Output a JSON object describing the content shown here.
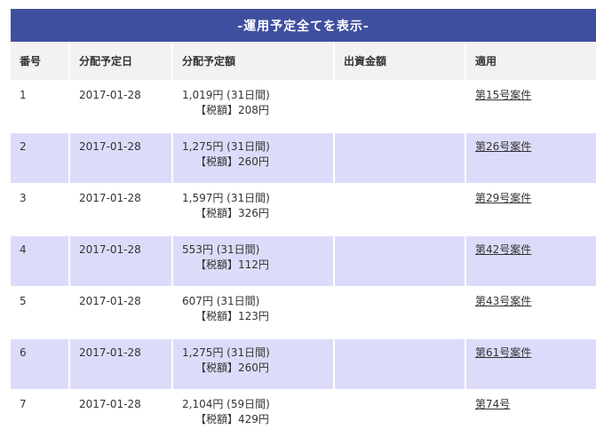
{
  "header": {
    "title": "-運用予定全てを表示-"
  },
  "table": {
    "columns": [
      "番号",
      "分配予定日",
      "分配予定額",
      "出資金額",
      "適用"
    ],
    "rows": [
      {
        "no": "1",
        "date": "2017-01-28",
        "amount": "1,019円 (31日間)",
        "tax": "【税額】208円",
        "investment": "",
        "apply": "第15号案件"
      },
      {
        "no": "2",
        "date": "2017-01-28",
        "amount": "1,275円 (31日間)",
        "tax": "【税額】260円",
        "investment": "",
        "apply": "第26号案件"
      },
      {
        "no": "3",
        "date": "2017-01-28",
        "amount": "1,597円 (31日間)",
        "tax": "【税額】326円",
        "investment": "",
        "apply": "第29号案件"
      },
      {
        "no": "4",
        "date": "2017-01-28",
        "amount": "553円 (31日間)",
        "tax": "【税額】112円",
        "investment": "",
        "apply": "第42号案件"
      },
      {
        "no": "5",
        "date": "2017-01-28",
        "amount": "607円 (31日間)",
        "tax": "【税額】123円",
        "investment": "",
        "apply": "第43号案件"
      },
      {
        "no": "6",
        "date": "2017-01-28",
        "amount": "1,275円 (31日間)",
        "tax": "【税額】260円",
        "investment": "",
        "apply": "第61号案件"
      },
      {
        "no": "7",
        "date": "2017-01-28",
        "amount": "2,104円 (59日間)",
        "tax": "【税額】429円",
        "investment": "",
        "apply": "第74号"
      }
    ]
  },
  "colors": {
    "header_bg": "#3f4f9f",
    "alt_row_bg": "#dcdcfa",
    "thead_bg": "#f2f2f2"
  }
}
